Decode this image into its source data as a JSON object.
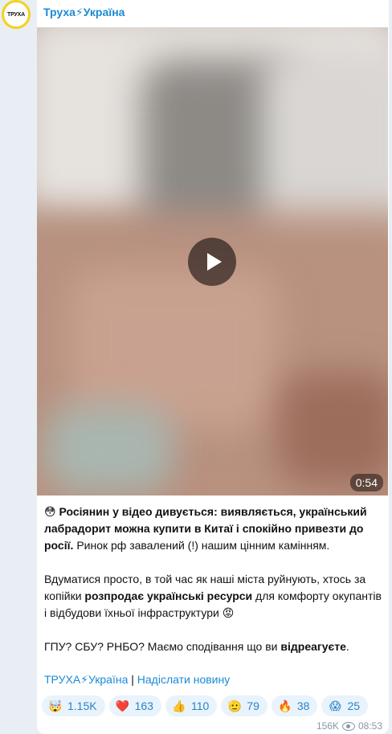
{
  "channel": {
    "name": "Труха⚡Україна",
    "avatar_text": "ТРУХА"
  },
  "video": {
    "duration": "0:54"
  },
  "post": {
    "p1_emoji": "😳",
    "p1_bold": "Росіянин у відео дивується: виявляється, український лабрадорит можна купити в Китаї і спокійно привезти до росії.",
    "p1_rest": "Ринок рф завалений (!) нашим цінним камінням.",
    "p2_a": "Вдуматися просто, в той час як наші міста руйнують, хтось за копійки ",
    "p2_bold": "розпродає українські ресурси",
    "p2_b": " для комфорту окупантів і відбудови їхньої інфраструктури ",
    "p2_emoji": "😡",
    "p3_a": "ГПУ? СБУ? РНБО? Маємо сподівання що ви ",
    "p3_bold": "відреагуєте",
    "p3_b": "."
  },
  "links": {
    "channel_link": "ТРУХА⚡Україна",
    "separator": "|",
    "send_news": "Надіслати новину"
  },
  "reactions": [
    {
      "emoji": "🤯",
      "count": "1.15K"
    },
    {
      "emoji": "❤️",
      "count": "163"
    },
    {
      "emoji": "👍",
      "count": "110"
    },
    {
      "emoji": "🫡",
      "count": "79"
    },
    {
      "emoji": "🔥",
      "count": "38"
    },
    {
      "emoji": "😱",
      "count": "25"
    }
  ],
  "meta": {
    "views": "156K",
    "time": "08:53"
  }
}
